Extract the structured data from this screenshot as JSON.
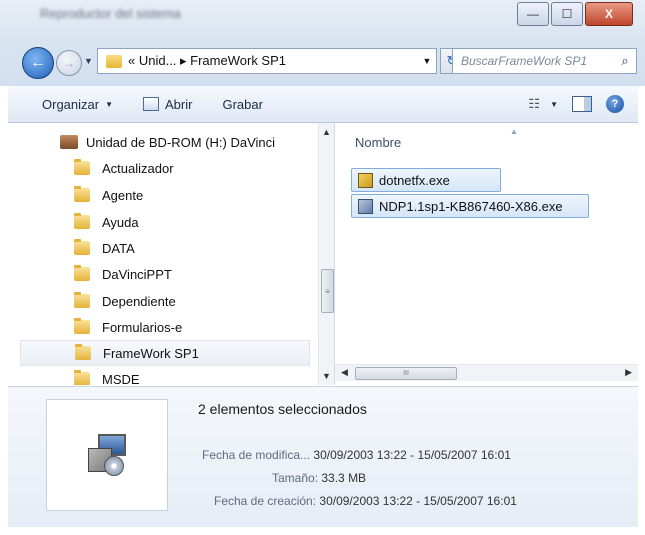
{
  "window": {
    "title_blurred": "Reproductor del sistema",
    "min_icon": "minimize-icon",
    "max_icon": "maximize-icon",
    "close_label": "X"
  },
  "address": {
    "back_icon": "back-arrow-icon",
    "forward_icon": "forward-arrow-icon",
    "path": "« Unid... ▸ FrameWork SP1",
    "refresh_symbol": "↻"
  },
  "search": {
    "placeholder": "BuscarFrameWork SP1"
  },
  "toolbar": {
    "organize_label": "Organizar",
    "open_label": "Abrir",
    "burn_label": "Grabar"
  },
  "nav": {
    "drive_label": "Unidad de BD-ROM (H:) DaVinci",
    "folders": [
      "Actualizador",
      "Agente",
      "Ayuda",
      "DATA",
      "DaVinciPPT",
      "Dependiente",
      "Formularios-e",
      "FrameWork SP1",
      "MSDE"
    ],
    "selected": "FrameWork SP1"
  },
  "files": {
    "column_header": "Nombre",
    "items": [
      {
        "name": "dotnetfx.exe",
        "icon": "exe-icon"
      },
      {
        "name": "NDP1.1sp1-KB867460-X86.exe",
        "icon": "setup-exe-icon"
      }
    ]
  },
  "details": {
    "selection_text": "2 elementos seleccionados",
    "modified_label": "Fecha de modifica...",
    "modified_value": "30/09/2003 13:22 - 15/05/2007 16:01",
    "size_label": "Tamaño:",
    "size_value": "33.3 MB",
    "created_label": "Fecha de creación:",
    "created_value": "30/09/2003 13:22 - 15/05/2007 16:01"
  }
}
